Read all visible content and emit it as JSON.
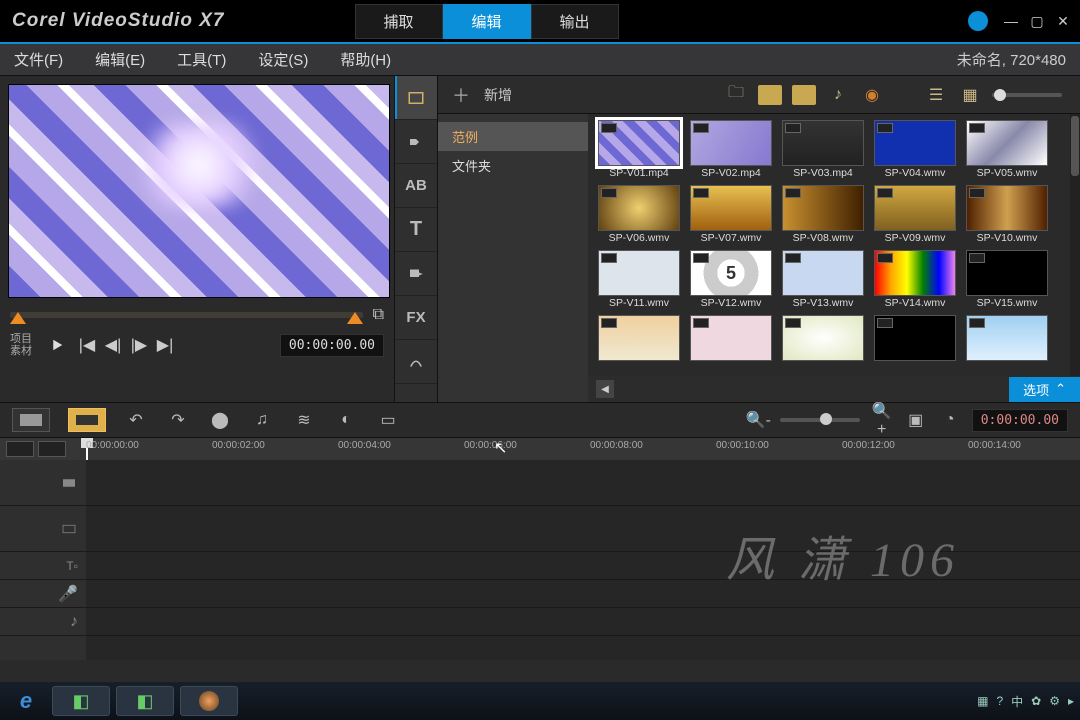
{
  "app_title": "Corel VideoStudio X7",
  "main_tabs": {
    "capture": "捕取",
    "edit": "编辑",
    "share": "输出"
  },
  "menu": {
    "file": "文件(F)",
    "edit": "编辑(E)",
    "tool": "工具(T)",
    "setting": "设定(S)",
    "help": "帮助(H)"
  },
  "status_right": "未命名,   720*480",
  "preview": {
    "proj_label": "项目",
    "clip_label": "素材",
    "timecode": "00:00:00.00"
  },
  "library": {
    "new_label": "新增",
    "tree": {
      "sample": "范例",
      "folder": "文件夹"
    },
    "browse": "浏览",
    "options": "选项",
    "clips": [
      {
        "label": "SP-V01.mp4",
        "cls": "t0",
        "sel": true
      },
      {
        "label": "SP-V02.mp4",
        "cls": "t1"
      },
      {
        "label": "SP-V03.mp4",
        "cls": "t2"
      },
      {
        "label": "SP-V04.wmv",
        "cls": "t3"
      },
      {
        "label": "SP-V05.wmv",
        "cls": "t4"
      },
      {
        "label": "SP-V06.wmv",
        "cls": "t5"
      },
      {
        "label": "SP-V07.wmv",
        "cls": "t6"
      },
      {
        "label": "SP-V08.wmv",
        "cls": "t7"
      },
      {
        "label": "SP-V09.wmv",
        "cls": "t8"
      },
      {
        "label": "SP-V10.wmv",
        "cls": "t9"
      },
      {
        "label": "SP-V11.wmv",
        "cls": "t10"
      },
      {
        "label": "SP-V12.wmv",
        "cls": "t11",
        "inner": "5"
      },
      {
        "label": "SP-V13.wmv",
        "cls": "t12"
      },
      {
        "label": "SP-V14.wmv",
        "cls": "t13"
      },
      {
        "label": "SP-V15.wmv",
        "cls": "t14"
      },
      {
        "label": "",
        "cls": "t15"
      },
      {
        "label": "",
        "cls": "t16"
      },
      {
        "label": "",
        "cls": "t17"
      },
      {
        "label": "",
        "cls": "t18"
      },
      {
        "label": "",
        "cls": "t19"
      }
    ]
  },
  "timeline": {
    "timecode": "0:00:00.00",
    "ticks": [
      "00:00:00:00",
      "00:00:02:00",
      "00:00:04:00",
      "00:00:06:00",
      "00:00:08:00",
      "00:00:10:00",
      "00:00:12:00",
      "00:00:14:00"
    ]
  },
  "watermark": "风 潇 106",
  "side_tools": [
    "media",
    "transition",
    "title",
    "graphic",
    "filter",
    "fx",
    "path"
  ],
  "countdown_digit": "5"
}
